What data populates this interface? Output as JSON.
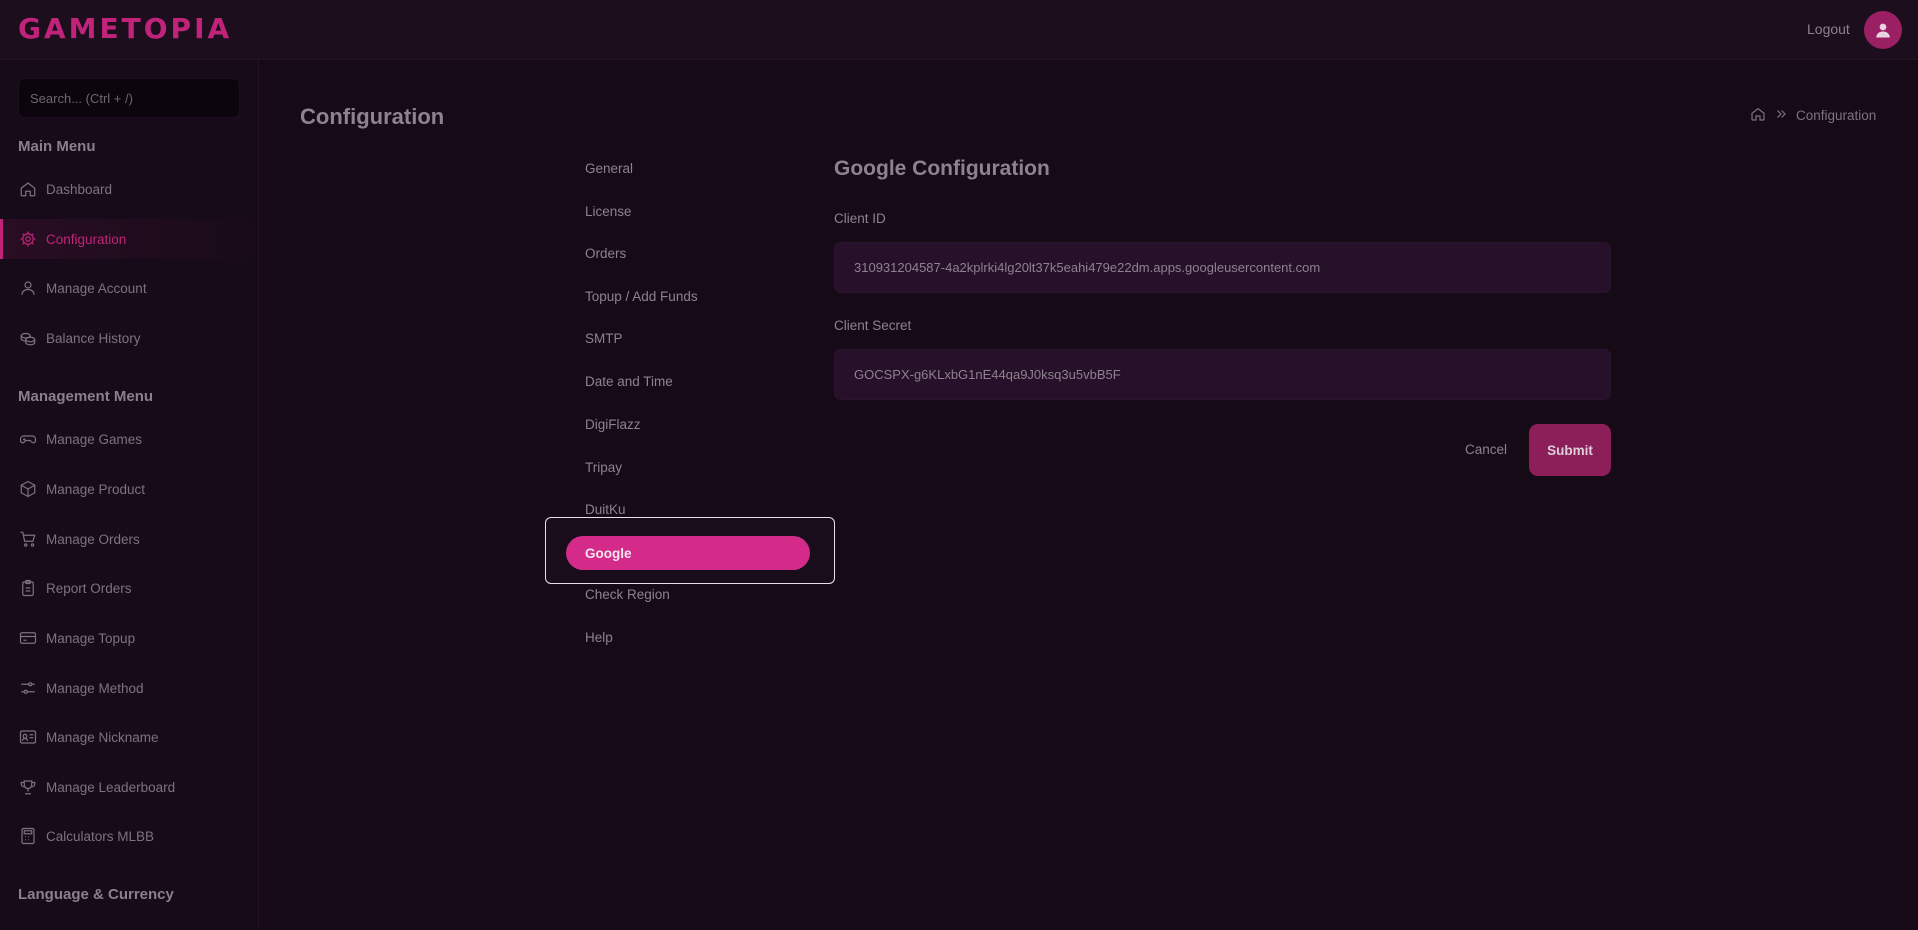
{
  "brand": {
    "logo": "GAMETOPIA"
  },
  "header": {
    "logout_label": "Logout"
  },
  "sidebar": {
    "search_placeholder": "Search... (Ctrl + /)",
    "main_menu_title": "Main Menu",
    "main_items": [
      {
        "label": "Dashboard",
        "icon": "home-icon"
      },
      {
        "label": "Configuration",
        "icon": "gear-icon",
        "active": true
      },
      {
        "label": "Manage Account",
        "icon": "user-icon"
      },
      {
        "label": "Balance History",
        "icon": "coins-icon"
      }
    ],
    "management_menu_title": "Management Menu",
    "management_items": [
      {
        "label": "Manage Games",
        "icon": "gamepad-icon"
      },
      {
        "label": "Manage Product",
        "icon": "box-icon"
      },
      {
        "label": "Manage Orders",
        "icon": "cart-icon"
      },
      {
        "label": "Report Orders",
        "icon": "clipboard-icon"
      },
      {
        "label": "Manage Topup",
        "icon": "card-icon"
      },
      {
        "label": "Manage Method",
        "icon": "sliders-icon"
      },
      {
        "label": "Manage Nickname",
        "icon": "id-card-icon"
      },
      {
        "label": "Manage Leaderboard",
        "icon": "trophy-icon"
      },
      {
        "label": "Calculators MLBB",
        "icon": "calculator-icon"
      }
    ],
    "language_title": "Language & Currency"
  },
  "page": {
    "title": "Configuration",
    "breadcrumb": {
      "current": "Configuration"
    }
  },
  "config_nav": {
    "items": [
      "General",
      "License",
      "Orders",
      "Topup / Add Funds",
      "SMTP",
      "Date and Time",
      "DigiFlazz",
      "Tripay",
      "DuitKu",
      "Google",
      "Check Region",
      "Help"
    ],
    "active": "Google"
  },
  "google_config": {
    "title": "Google Configuration",
    "client_id_label": "Client ID",
    "client_id_value": "310931204587-4a2kplrki4lg20lt37k5eahi479e22dm.apps.googleusercontent.com",
    "client_secret_label": "Client Secret",
    "client_secret_value": "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",
    "cancel_label": "Cancel",
    "submit_label": "Submit"
  },
  "colors": {
    "accent": "#c2237a",
    "pill": "#d42b8a",
    "background": "#160a17"
  }
}
